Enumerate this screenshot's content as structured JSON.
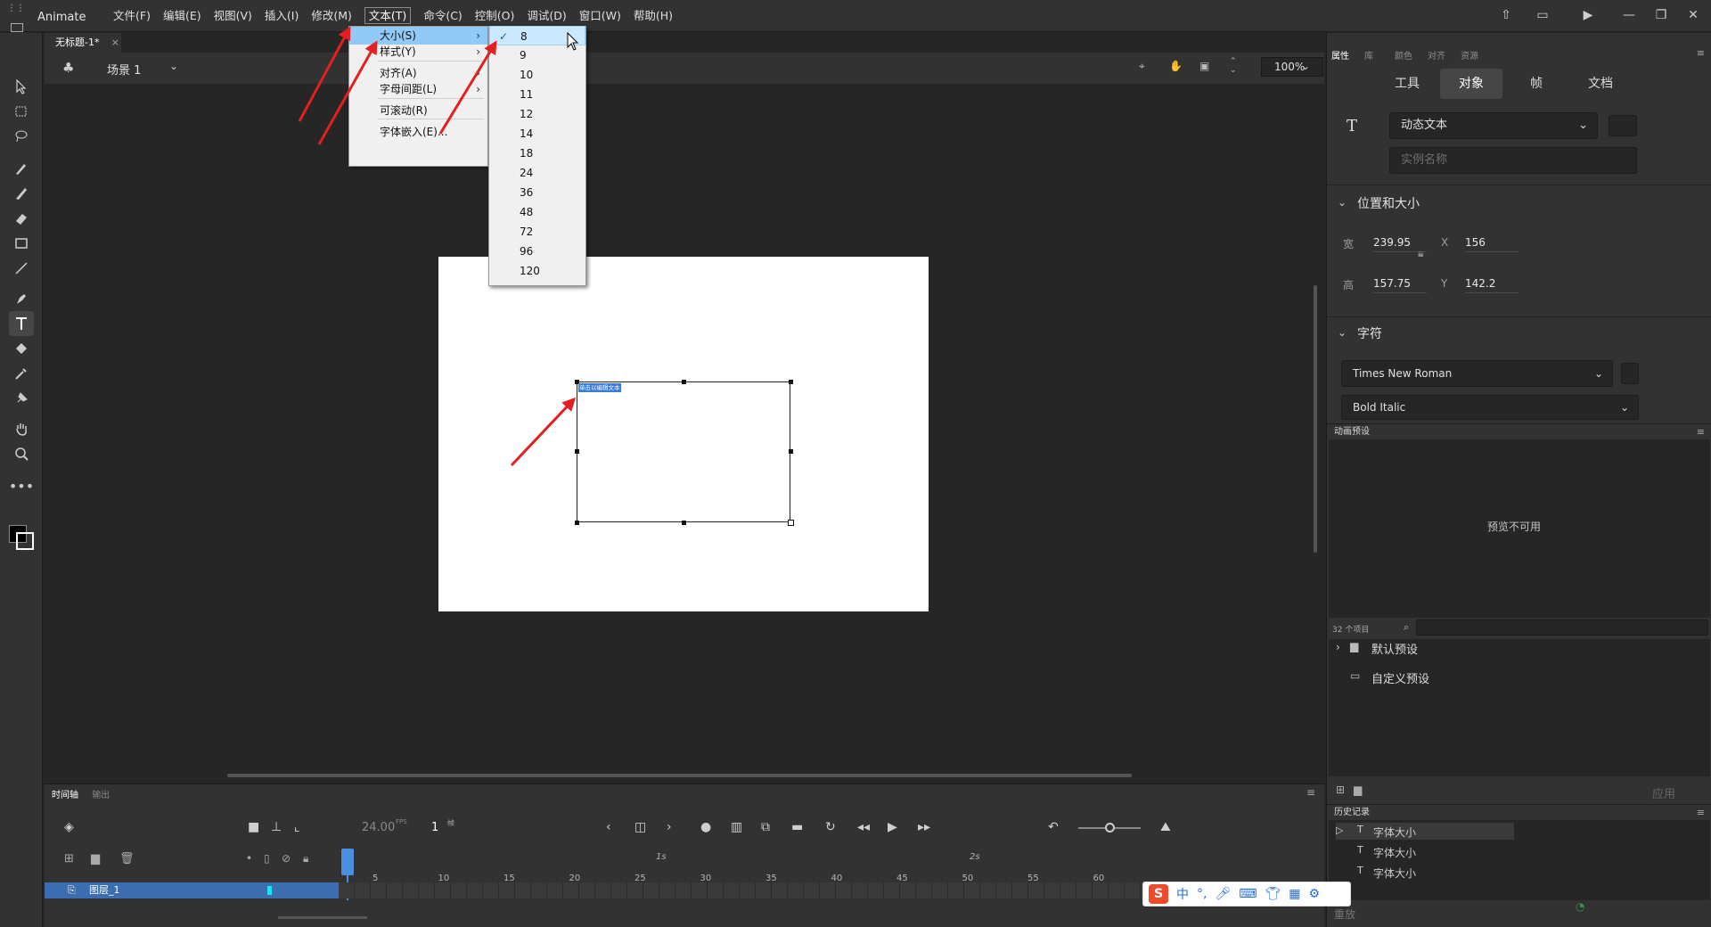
{
  "app": {
    "name": "Animate"
  },
  "menubar": {
    "items": [
      "文件(F)",
      "编辑(E)",
      "视图(V)",
      "插入(I)",
      "修改(M)",
      "文本(T)",
      "命令(C)",
      "控制(O)",
      "调试(D)",
      "窗口(W)",
      "帮助(H)"
    ],
    "active": "文本(T)"
  },
  "doc_tab": {
    "title": "无标题-1*",
    "close": "×"
  },
  "scene": {
    "label": "场景 1",
    "zoom": "100%"
  },
  "text_menu": {
    "items": [
      {
        "label": "大小(S)",
        "submenu": true,
        "highlighted": true
      },
      {
        "label": "样式(Y)",
        "submenu": true
      },
      {
        "label": "对齐(A)",
        "submenu": true
      },
      {
        "label": "字母间距(L)",
        "submenu": true
      },
      {
        "label": "可滚动(R)",
        "submenu": false
      },
      {
        "label": "字体嵌入(E)...",
        "submenu": false
      }
    ]
  },
  "size_menu": {
    "items": [
      "8",
      "9",
      "10",
      "11",
      "12",
      "14",
      "18",
      "24",
      "36",
      "48",
      "72",
      "96",
      "120"
    ],
    "checked": "8"
  },
  "stage_text": "单击以编辑文本",
  "properties": {
    "tabs": [
      "属性",
      "库",
      "颜色",
      "对齐",
      "资源"
    ],
    "segments": [
      "工具",
      "对象",
      "帧",
      "文档"
    ],
    "active_segment": "对象",
    "text_type": "动态文本",
    "instance_placeholder": "实例名称",
    "position_section": "位置和大小",
    "width_label": "宽",
    "width": "239.95",
    "height_label": "高",
    "height": "157.75",
    "x_label": "X",
    "x": "156",
    "y_label": "Y",
    "y": "142.2",
    "char_section": "字符",
    "font": "Times New Roman",
    "style": "Bold Italic"
  },
  "motion_presets": {
    "title": "动画预设",
    "preview": "预览不可用",
    "count": "32 个项目",
    "folders": [
      "默认预设",
      "自定义预设"
    ],
    "apply": "应用"
  },
  "history": {
    "title": "历史记录",
    "items": [
      "字体大小",
      "字体大小",
      "字体大小"
    ],
    "replay": "重放"
  },
  "timeline": {
    "tabs": [
      "时间轴",
      "输出"
    ],
    "fps": "24.00",
    "fps_unit": "FPS",
    "frame": "1",
    "frame_unit": "帧",
    "layer_name": "图层_1",
    "frame_numbers": [
      "5",
      "10",
      "15",
      "20",
      "25",
      "30",
      "35",
      "40",
      "45",
      "50",
      "55",
      "60"
    ],
    "sec_marks": [
      "1s",
      "2s"
    ]
  },
  "ime": {
    "label": "中"
  },
  "colors": {
    "highlight": "#91c9f7",
    "arrow": "#e31f1f",
    "layer": "#3c6db0"
  }
}
